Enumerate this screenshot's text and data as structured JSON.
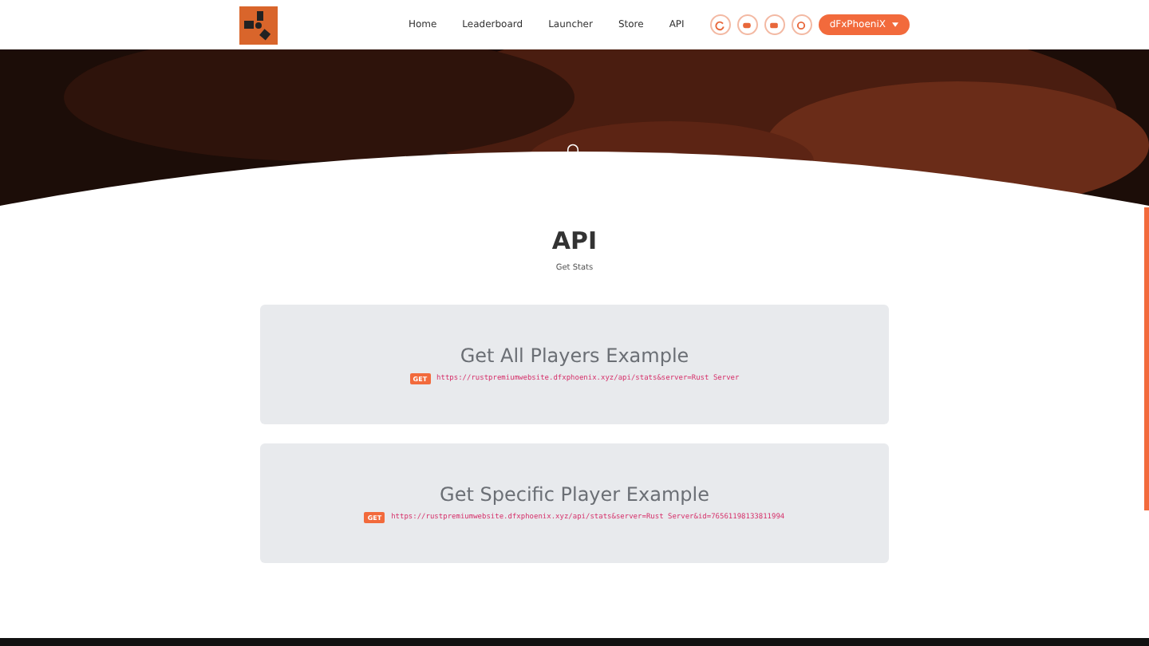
{
  "nav": {
    "links": [
      {
        "label": "Home"
      },
      {
        "label": "Leaderboard"
      },
      {
        "label": "Launcher"
      },
      {
        "label": "Store"
      },
      {
        "label": "API"
      }
    ],
    "user": {
      "label": "dFxPhoeniX"
    }
  },
  "page": {
    "title": "API",
    "subtitle": "Get Stats"
  },
  "examples": [
    {
      "title": "Get All Players Example",
      "method": "GET",
      "url": "https://rustpremiumwebsite.dfxphoenix.xyz/api/stats&server=Rust Server"
    },
    {
      "title": "Get Specific Player Example",
      "method": "GET",
      "url": "https://rustpremiumwebsite.dfxphoenix.xyz/api/stats&server=Rust Server&id=76561198133811994"
    }
  ]
}
